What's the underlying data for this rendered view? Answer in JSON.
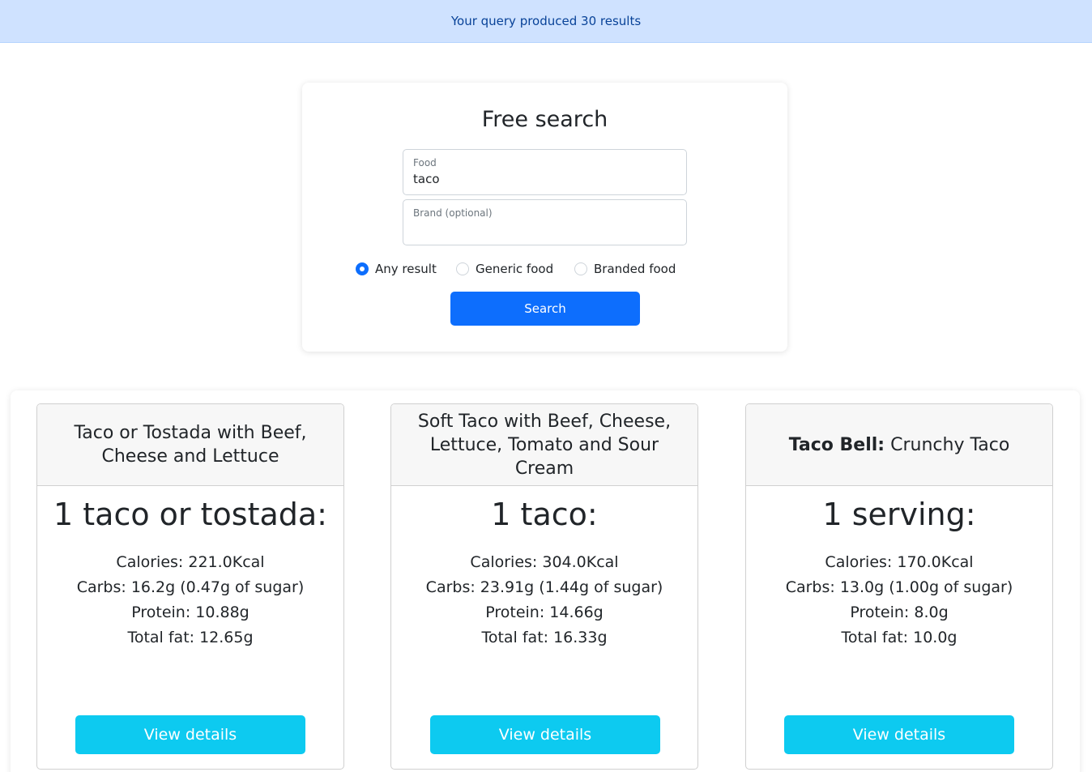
{
  "alert": {
    "text": "Your query produced 30 results"
  },
  "search": {
    "title": "Free search",
    "food_label": "Food",
    "food_value": "taco",
    "brand_label": "Brand (optional)",
    "brand_value": "",
    "radio_options": [
      {
        "label": "Any result",
        "checked": true
      },
      {
        "label": "Generic food",
        "checked": false
      },
      {
        "label": "Branded food",
        "checked": false
      }
    ],
    "search_button": "Search"
  },
  "results": [
    {
      "brand": "",
      "name": "Taco or Tostada with Beef, Cheese and Lettuce",
      "serving": "1 taco or tostada:",
      "calories": "Calories: 221.0Kcal",
      "carbs": "Carbs: 16.2g (0.47g of sugar)",
      "protein": "Protein: 10.88g",
      "fat": "Total fat: 12.65g",
      "button": "View details"
    },
    {
      "brand": "",
      "name": "Soft Taco with Beef, Cheese, Lettuce, Tomato and Sour Cream",
      "serving": "1 taco:",
      "calories": "Calories: 304.0Kcal",
      "carbs": "Carbs: 23.91g (1.44g of sugar)",
      "protein": "Protein: 14.66g",
      "fat": "Total fat: 16.33g",
      "button": "View details"
    },
    {
      "brand": "Taco Bell:",
      "name": "Crunchy Taco",
      "serving": "1 serving:",
      "calories": "Calories: 170.0Kcal",
      "carbs": "Carbs: 13.0g (1.00g of sugar)",
      "protein": "Protein: 8.0g",
      "fat": "Total fat: 10.0g",
      "button": "View details"
    }
  ],
  "colors": {
    "alert_bg": "#cfe2ff",
    "primary": "#0d6efd",
    "info": "#0dcaf0"
  }
}
